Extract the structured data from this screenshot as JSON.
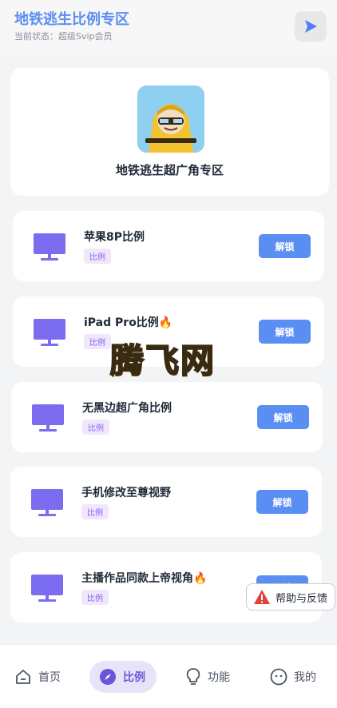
{
  "header": {
    "title": "地铁逃生比例专区",
    "status": "当前状态：超级Svip会员"
  },
  "hero": {
    "title": "地铁逃生超广角专区"
  },
  "cards": [
    {
      "title": "苹果8P比例",
      "tag": "比例",
      "button": "解锁"
    },
    {
      "title": "iPad Pro比例🔥",
      "tag": "比例",
      "button": "解锁"
    },
    {
      "title": "无黑边超广角比例",
      "tag": "比例",
      "button": "解锁"
    },
    {
      "title": "手机修改至尊视野",
      "tag": "比例",
      "button": "解锁"
    },
    {
      "title": "主播作品同款上帝视角🔥",
      "tag": "比例",
      "button": "解锁"
    }
  ],
  "watermark": "腾飞网",
  "feedback": {
    "label": "帮助与反馈"
  },
  "nav": {
    "items": [
      {
        "label": "首页",
        "icon": "home-icon"
      },
      {
        "label": "比例",
        "icon": "compass-icon"
      },
      {
        "label": "功能",
        "icon": "lightbulb-icon"
      },
      {
        "label": "我的",
        "icon": "face-icon"
      }
    ]
  },
  "colors": {
    "accent": "#5b8ef2",
    "monitor": "#7b6cf0",
    "tag_bg": "#efe8fb",
    "active_nav_bg": "#e6e4f7"
  }
}
